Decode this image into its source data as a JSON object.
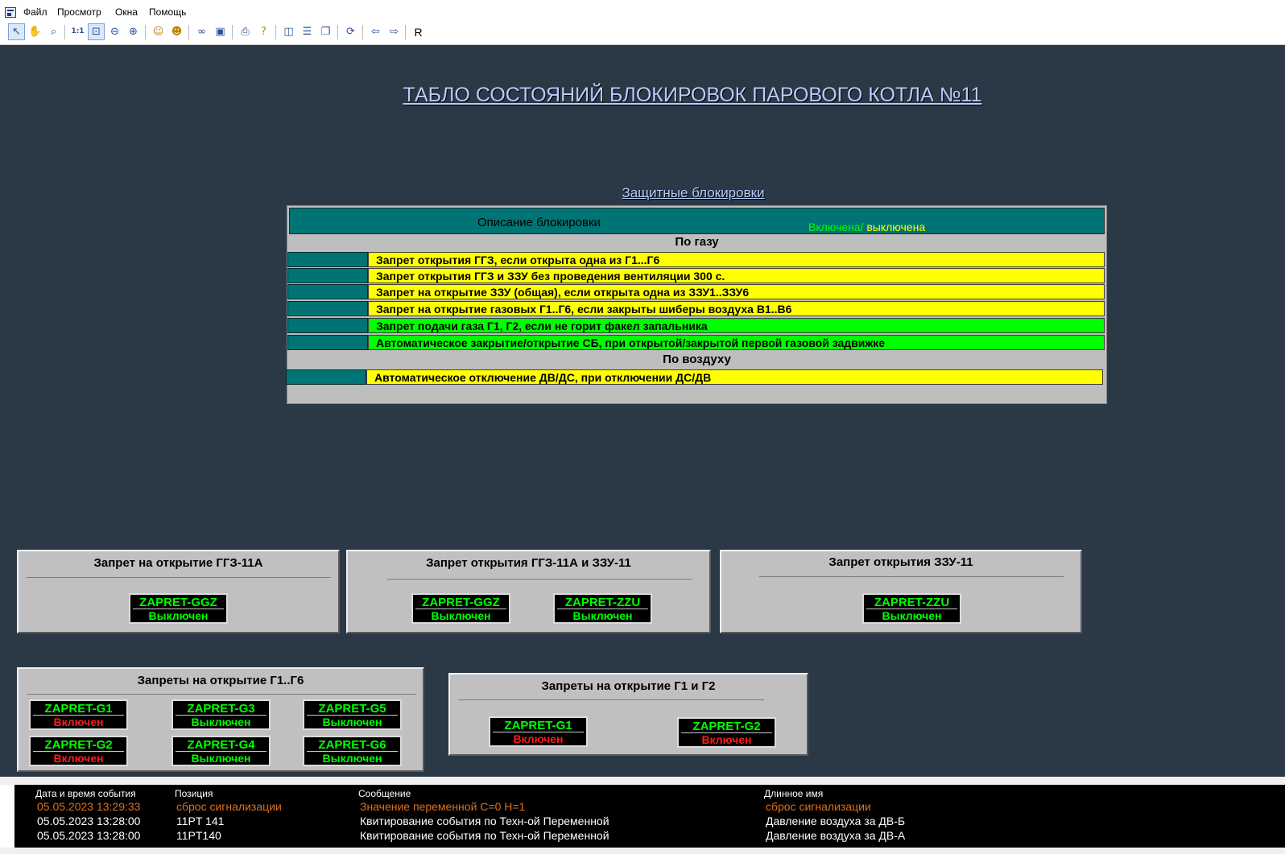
{
  "menu": {
    "items": [
      "Файл",
      "Просмотр",
      "Окна",
      "Помощь"
    ]
  },
  "toolbar": {
    "icons": [
      "pointer-icon",
      "hand-icon",
      "magnifier-icon",
      "zoom-1to1-icon",
      "zoom-fit-icon",
      "zoom-out-icon",
      "zoom-in-icon",
      "user-icon",
      "user-remove-icon",
      "binoculars-icon",
      "tag-icon",
      "print-icon",
      "help-icon",
      "layout-columns-icon",
      "layout-rows-icon",
      "windows-icon",
      "refresh-icon",
      "arrow-left-icon",
      "arrow-right-icon"
    ],
    "r_label": "R"
  },
  "screen": {
    "title": "ТАБЛО СОСТОЯНИЙ БЛОКИРОВОК ПАРОВОГО КОТЛА №11",
    "section_title": "Защитные блокировки"
  },
  "lock_table": {
    "header_desc": "Описание блокировки",
    "header_on": "Включена/",
    "header_off": " выключена",
    "gas_title": "По газу",
    "gas_rows": [
      {
        "text": "Запрет открытия ГГЗ, если открыта одна из Г1...Г6",
        "color": "#ffff00"
      },
      {
        "text": "Запрет открытия ГГЗ и ЗЗУ без проведения вентиляции 300 с.",
        "color": "#ffff00"
      },
      {
        "text": "Запрет на открытие ЗЗУ (общая), если открыта одна из ЗЗУ1..ЗЗУ6",
        "color": "#ffff00"
      },
      {
        "text": "Запрет на открытие газовых Г1..Г6, если закрыты шиберы воздуха В1..В6",
        "color": "#ffff00"
      },
      {
        "text": "Запрет подачи газа Г1, Г2, если не горит факел запальника",
        "color": "#00ff00"
      },
      {
        "text": "Автоматическое закрытие/открытие СБ, при открытой/закрытой первой газовой задвижке",
        "color": "#00ff00"
      }
    ],
    "air_title": "По воздуху",
    "air_rows": [
      {
        "text": "Автоматическое отключение ДВ/ДС, при отключении ДС/ДВ",
        "color": "#ffff00"
      }
    ]
  },
  "panels": {
    "ggz": {
      "title": "Запрет на открытие ГГЗ-11А",
      "ind1": {
        "name": "ZAPRET-GGZ",
        "state": "Выключен"
      }
    },
    "ggz_zzu": {
      "title": "Запрет открытия ГГЗ-11А и ЗЗУ-11",
      "ind1": {
        "name": "ZAPRET-GGZ",
        "state": "Выключен"
      },
      "ind2": {
        "name": "ZAPRET-ZZU",
        "state": "Выключен"
      }
    },
    "zzu": {
      "title": "Запрет открытия ЗЗУ-11",
      "ind1": {
        "name": "ZAPRET-ZZU",
        "state": "Выключен"
      }
    },
    "g1g6": {
      "title": "Запреты на открытие Г1..Г6",
      "g1": {
        "name": "ZAPRET-G1",
        "state": "Включен"
      },
      "g2": {
        "name": "ZAPRET-G2",
        "state": "Включен"
      },
      "g3": {
        "name": "ZAPRET-G3",
        "state": "Выключен"
      },
      "g4": {
        "name": "ZAPRET-G4",
        "state": "Выключен"
      },
      "g5": {
        "name": "ZAPRET-G5",
        "state": "Выключен"
      },
      "g6": {
        "name": "ZAPRET-G6",
        "state": "Выключен"
      }
    },
    "g1g2": {
      "title": "Запреты на открытие Г1 и Г2",
      "g1": {
        "name": "ZAPRET-G1",
        "state": "Включен"
      },
      "g2": {
        "name": "ZAPRET-G2",
        "state": "Включен"
      }
    }
  },
  "event_log": {
    "headers": {
      "datetime": "Дата и время события",
      "position": "Позиция",
      "message": "Сообщение",
      "longname": "Длинное имя"
    },
    "rows": [
      {
        "datetime": "05.05.2023 13:29:33",
        "position": "сброс сигнализации",
        "message": "Значение переменной С=0  Н=1",
        "longname": "сброс сигнализации",
        "color": "#e0701a"
      },
      {
        "datetime": "05.05.2023 13:28:00",
        "position": "11PT 141",
        "message": "Квитирование события по Техн-ой Переменной",
        "longname": "Давление воздуха за ДВ-Б",
        "color": "#ffffff"
      },
      {
        "datetime": "05.05.2023 13:28:00",
        "position": "11PT140",
        "message": "Квитирование события по Техн-ой Переменной",
        "longname": "Давление воздуха за ДВ-А",
        "color": "#ffffff"
      }
    ]
  }
}
